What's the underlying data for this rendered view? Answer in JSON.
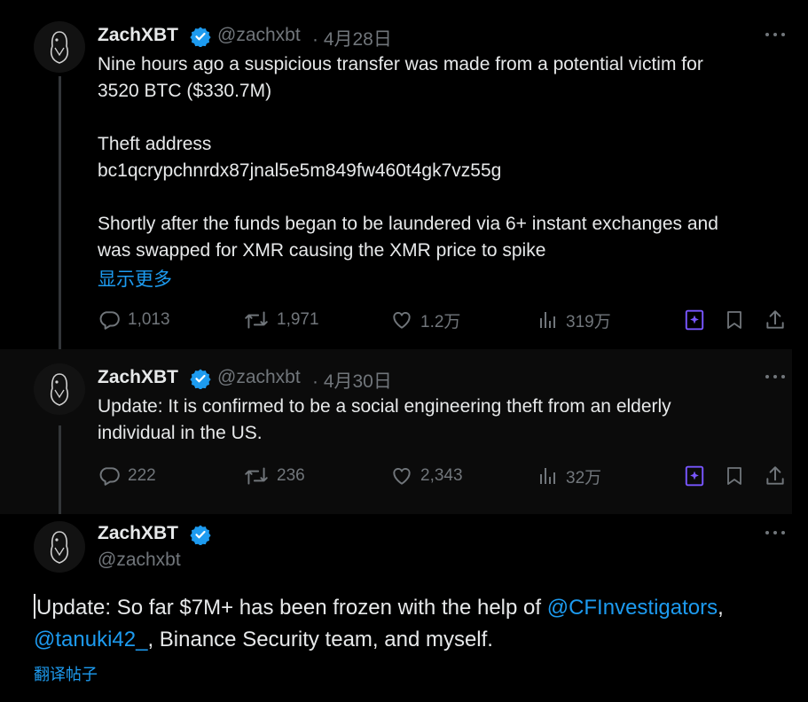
{
  "tweets": [
    {
      "name": "ZachXBT",
      "handle": "@zachxbt",
      "date": "· 4月28日",
      "body": "Nine hours ago a suspicious transfer was made from a potential victim for\n3520 BTC ($330.7M)\n\nTheft address\nbc1qcrypchnrdx87jnal5e5m849fw460t4gk7vz55g\n\nShortly after the funds began to be laundered via 6+ instant exchanges and\nwas swapped for XMR causing the XMR price to spike",
      "show_more": "显示更多",
      "replies": "1,013",
      "reposts": "1,971",
      "likes": "1.2万",
      "views": "319万"
    },
    {
      "name": "ZachXBT",
      "handle": "@zachxbt",
      "date": "· 4月30日",
      "body": "Update: It is confirmed to be a social engineering theft from an elderly\nindividual in the US.",
      "replies": "222",
      "reposts": "236",
      "likes": "2,343",
      "views": "32万"
    },
    {
      "name": "ZachXBT",
      "handle": "@zachxbt",
      "body_prefix": "Update: So far $7M+ has been frozen with the help of ",
      "mention1": "@CFInvestigators",
      "body_mid": ",",
      "mention2": "@tanuki42_",
      "body_suffix": ", Binance Security team, and myself.",
      "translate": "翻译帖子"
    }
  ],
  "colors": {
    "accent": "#1d9bf0",
    "verified": "#1d9bf0",
    "grok": "#7856ff",
    "muted": "#71767b",
    "text": "#e7e9ea"
  },
  "icons": [
    "reply-icon",
    "repost-icon",
    "like-icon",
    "views-icon",
    "grok-icon",
    "bookmark-icon",
    "share-icon",
    "more-icon",
    "verified-icon"
  ]
}
